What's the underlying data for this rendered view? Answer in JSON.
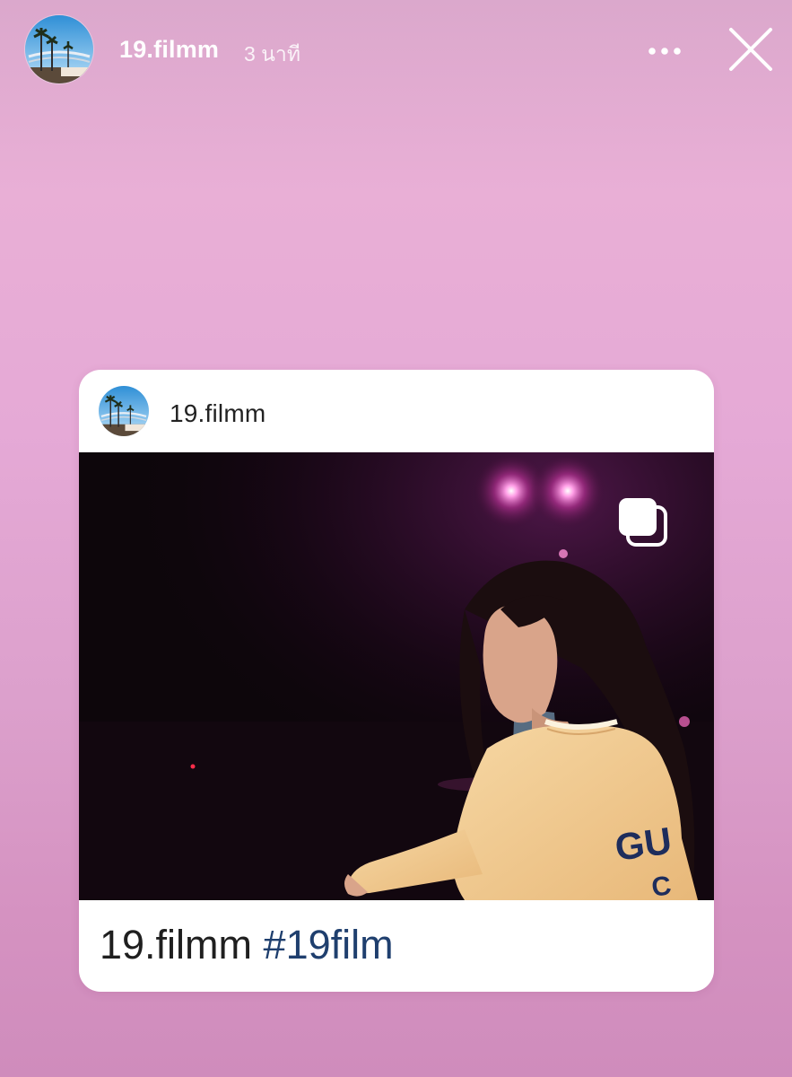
{
  "story": {
    "username": "19.filmm",
    "timestamp": "3 นาที",
    "avatar_icon": "palm-tree-sky-avatar",
    "more_icon": "more-horizontal-icon",
    "close_icon": "close-icon"
  },
  "shared_post": {
    "username": "19.filmm",
    "avatar_icon": "palm-tree-sky-avatar",
    "photo_description_icon": "dancer-photo",
    "multi_icon": "carousel-multiple-icon",
    "caption_user": "19.filmm",
    "caption_hashtag": "#19film"
  },
  "colors": {
    "background_top": "#dba8cc",
    "background_bottom": "#cf8cbc",
    "hashtag": "#1f3f6e",
    "card": "#ffffff"
  }
}
